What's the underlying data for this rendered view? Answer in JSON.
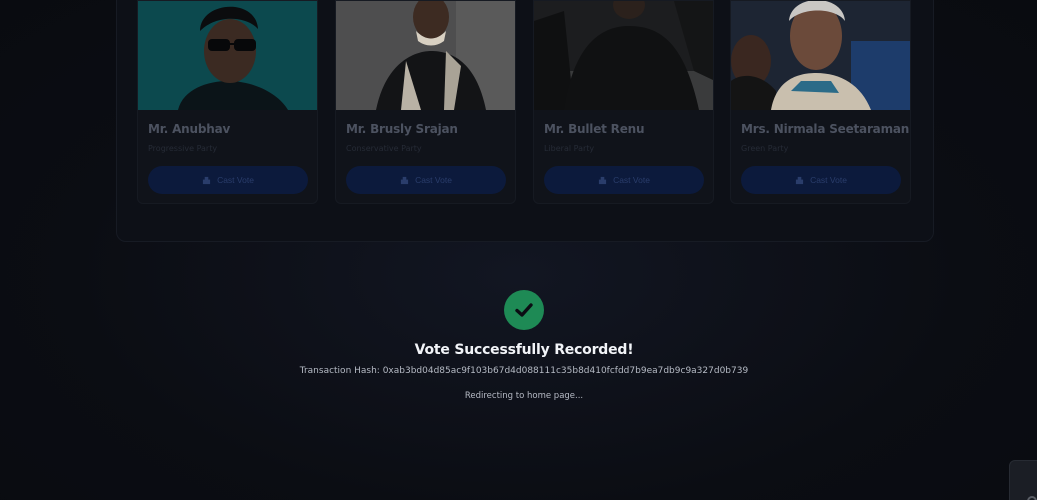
{
  "candidates": [
    {
      "name": "Mr. Anubhav",
      "party": "Progressive Party",
      "button": "Cast Vote"
    },
    {
      "name": "Mr. Brusly Srajan",
      "party": "Conservative Party",
      "button": "Cast Vote"
    },
    {
      "name": "Mr. Bullet Renu",
      "party": "Liberal Party",
      "button": "Cast Vote"
    },
    {
      "name": "Mrs. Nirmala Seetaraman",
      "party": "Green Party",
      "button": "Cast Vote"
    }
  ],
  "success": {
    "icon": "check-circle-icon",
    "title": "Vote Successfully Recorded!",
    "hash": "Transaction Hash: 0xab3bd04d85ac9f103b67d4d088111c35b8d410fcfdd7b9ea7db9c9a327d0b739",
    "redirect": "Redirecting to home page..."
  },
  "colors": {
    "success_green": "#1e8a55",
    "vote_button": "#0c1a3c"
  }
}
